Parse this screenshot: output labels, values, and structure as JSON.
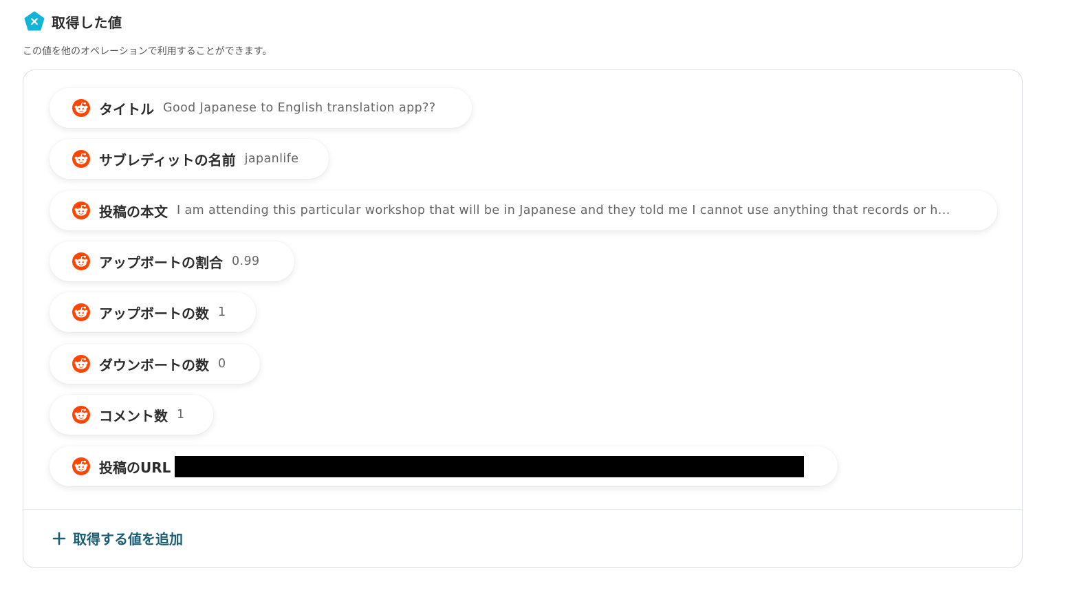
{
  "header": {
    "title": "取得した値",
    "icon": "yoom-x-icon",
    "icon_color": "#14b4d8"
  },
  "subtitle": "この値を他のオペレーションで利用することができます。",
  "fields": [
    {
      "label": "タイトル",
      "value": "Good Japanese to English translation app??"
    },
    {
      "label": "サブレディットの名前",
      "value": "japanlife"
    },
    {
      "label": "投稿の本文",
      "value": "I am attending this particular workshop that will be in Japanese and they told me I cannot use anything that records or h..."
    },
    {
      "label": "アップボートの割合",
      "value": "0.99"
    },
    {
      "label": "アップボートの数",
      "value": "1"
    },
    {
      "label": "ダウンボートの数",
      "value": "0"
    },
    {
      "label": "コメント数",
      "value": "1"
    },
    {
      "label": "投稿のURL",
      "value": ""
    }
  ],
  "field_icon": "reddit-icon",
  "reddit_color": "#ff4500",
  "add_button": {
    "label": "取得する値を追加",
    "color": "#1a5f73"
  }
}
